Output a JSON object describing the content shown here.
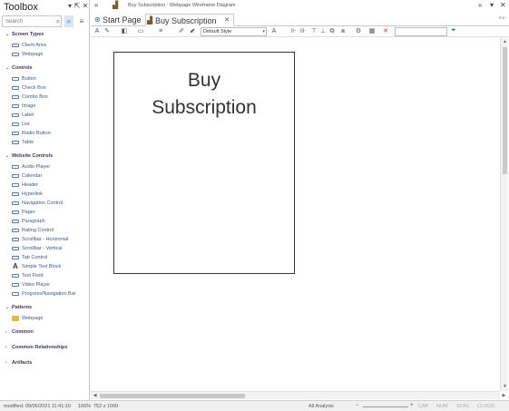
{
  "toolbox": {
    "title": "Toolbox",
    "search_placeholder": "Search",
    "groups": [
      {
        "label": "Screen Types",
        "items": [
          "Client Area",
          "Webpage"
        ]
      },
      {
        "label": "Controls",
        "items": [
          "Button",
          "Check Box",
          "Combo Box",
          "Image",
          "Label",
          "List",
          "Radio Button",
          "Table"
        ]
      },
      {
        "label": "Website Controls",
        "items": [
          "Audio Player",
          "Calendar",
          "Header",
          "Hyperlink",
          "Navigation Control",
          "Pager",
          "Paragraph",
          "Rating Control",
          "Scrollbar - Horizontal",
          "Scrollbar - Vertical",
          "Tab Control",
          "Simple Text Block",
          "Text Field",
          "Video Player",
          "Progress/Navigation Bar"
        ]
      },
      {
        "label": "Patterns",
        "items": [
          "Webpage"
        ]
      },
      {
        "label": "Common",
        "items": []
      },
      {
        "label": "Common Relationships",
        "items": []
      },
      {
        "label": "Artifacts",
        "items": []
      }
    ]
  },
  "titlebar": {
    "text": "Buy Subscription : Webpage Wireframe Diagram"
  },
  "tabs": [
    {
      "label": "Start Page"
    },
    {
      "label": "Buy Subscription"
    }
  ],
  "diagram_toolbar": {
    "style_value": "Default Style"
  },
  "canvas": {
    "heading_line1": "Buy",
    "heading_line2": "Subscription"
  },
  "statusbar": {
    "modified": "modified: 09/06/2021 11:41:10",
    "zoom": "166%",
    "size": "752 x 1000",
    "mode": "All Analysis",
    "cap": "CAP",
    "num": "NUM",
    "scrl": "SCRL",
    "cloud": "CLOUD"
  }
}
